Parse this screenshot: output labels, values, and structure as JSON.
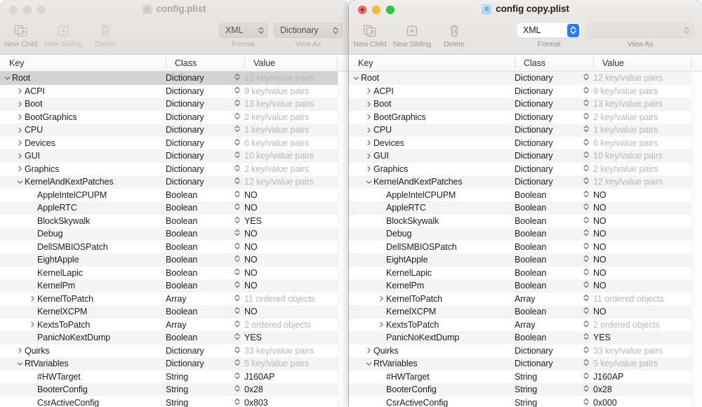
{
  "windows": [
    {
      "id": "left",
      "state": "inactive",
      "title": "config.plist",
      "doc_icon": "plist-document-icon",
      "traffic_lights": [
        "close-button",
        "minimize-button",
        "zoom-button"
      ],
      "toolbar": {
        "items": [
          {
            "label": "New Child",
            "icon": "new-child-icon",
            "enabled": true
          },
          {
            "label": "New Sibling",
            "icon": "new-sibling-icon",
            "enabled": false
          },
          {
            "label": "Delete",
            "icon": "trash-icon",
            "enabled": false
          }
        ],
        "format_popup": {
          "value": "XML",
          "sublabel": "Format"
        },
        "viewas_popup": {
          "value": "Dictionary",
          "sublabel": "View As"
        }
      },
      "columns": [
        "Key",
        "Class",
        "Value"
      ],
      "rows": [
        {
          "key": "Root",
          "class": "Dictionary",
          "value": "12 key/value pairs",
          "indent": 0,
          "disclosure": "open",
          "muted_value": true,
          "selected": true,
          "value_stepper": false
        },
        {
          "key": "ACPI",
          "class": "Dictionary",
          "value": "9 key/value pairs",
          "indent": 1,
          "disclosure": "closed",
          "muted_value": true,
          "selected": false,
          "value_stepper": false
        },
        {
          "key": "Boot",
          "class": "Dictionary",
          "value": "13 key/value pairs",
          "indent": 1,
          "disclosure": "closed",
          "muted_value": true,
          "selected": false,
          "value_stepper": false
        },
        {
          "key": "BootGraphics",
          "class": "Dictionary",
          "value": "2 key/value pairs",
          "indent": 1,
          "disclosure": "closed",
          "muted_value": true,
          "selected": false,
          "value_stepper": false
        },
        {
          "key": "CPU",
          "class": "Dictionary",
          "value": "1 key/value pairs",
          "indent": 1,
          "disclosure": "closed",
          "muted_value": true,
          "selected": false,
          "value_stepper": false
        },
        {
          "key": "Devices",
          "class": "Dictionary",
          "value": "6 key/value pairs",
          "indent": 1,
          "disclosure": "closed",
          "muted_value": true,
          "selected": false,
          "value_stepper": false
        },
        {
          "key": "GUI",
          "class": "Dictionary",
          "value": "10 key/value pairs",
          "indent": 1,
          "disclosure": "closed",
          "muted_value": true,
          "selected": false,
          "value_stepper": false
        },
        {
          "key": "Graphics",
          "class": "Dictionary",
          "value": "2 key/value pairs",
          "indent": 1,
          "disclosure": "closed",
          "muted_value": true,
          "selected": false,
          "value_stepper": false
        },
        {
          "key": "KernelAndKextPatches",
          "class": "Dictionary",
          "value": "12 key/value pairs",
          "indent": 1,
          "disclosure": "open",
          "muted_value": true,
          "selected": false,
          "value_stepper": false
        },
        {
          "key": "AppleIntelCPUPM",
          "class": "Boolean",
          "value": "NO",
          "indent": 2,
          "disclosure": "none",
          "muted_value": false,
          "selected": false,
          "value_stepper": true
        },
        {
          "key": "AppleRTC",
          "class": "Boolean",
          "value": "NO",
          "indent": 2,
          "disclosure": "none",
          "muted_value": false,
          "selected": false,
          "value_stepper": true
        },
        {
          "key": "BlockSkywalk",
          "class": "Boolean",
          "value": "YES",
          "indent": 2,
          "disclosure": "none",
          "muted_value": false,
          "selected": false,
          "value_stepper": true
        },
        {
          "key": "Debug",
          "class": "Boolean",
          "value": "NO",
          "indent": 2,
          "disclosure": "none",
          "muted_value": false,
          "selected": false,
          "value_stepper": true
        },
        {
          "key": "DellSMBIOSPatch",
          "class": "Boolean",
          "value": "NO",
          "indent": 2,
          "disclosure": "none",
          "muted_value": false,
          "selected": false,
          "value_stepper": true
        },
        {
          "key": "EightApple",
          "class": "Boolean",
          "value": "NO",
          "indent": 2,
          "disclosure": "none",
          "muted_value": false,
          "selected": false,
          "value_stepper": true
        },
        {
          "key": "KernelLapic",
          "class": "Boolean",
          "value": "NO",
          "indent": 2,
          "disclosure": "none",
          "muted_value": false,
          "selected": false,
          "value_stepper": true
        },
        {
          "key": "KernelPm",
          "class": "Boolean",
          "value": "NO",
          "indent": 2,
          "disclosure": "none",
          "muted_value": false,
          "selected": false,
          "value_stepper": true
        },
        {
          "key": "KernelToPatch",
          "class": "Array",
          "value": "11 ordered objects",
          "indent": 2,
          "disclosure": "closed",
          "muted_value": true,
          "selected": false,
          "value_stepper": false
        },
        {
          "key": "KernelXCPM",
          "class": "Boolean",
          "value": "NO",
          "indent": 2,
          "disclosure": "none",
          "muted_value": false,
          "selected": false,
          "value_stepper": true
        },
        {
          "key": "KextsToPatch",
          "class": "Array",
          "value": "2 ordered objects",
          "indent": 2,
          "disclosure": "closed",
          "muted_value": true,
          "selected": false,
          "value_stepper": false
        },
        {
          "key": "PanicNoKextDump",
          "class": "Boolean",
          "value": "YES",
          "indent": 2,
          "disclosure": "none",
          "muted_value": false,
          "selected": false,
          "value_stepper": true
        },
        {
          "key": "Quirks",
          "class": "Dictionary",
          "value": "33 key/value pairs",
          "indent": 1,
          "disclosure": "closed",
          "muted_value": true,
          "selected": false,
          "value_stepper": false
        },
        {
          "key": "RtVariables",
          "class": "Dictionary",
          "value": "5 key/value pairs",
          "indent": 1,
          "disclosure": "open",
          "muted_value": true,
          "selected": false,
          "value_stepper": false
        },
        {
          "key": "#HWTarget",
          "class": "String",
          "value": "J160AP",
          "indent": 2,
          "disclosure": "none",
          "muted_value": false,
          "selected": false,
          "value_stepper": false
        },
        {
          "key": "BooterConfig",
          "class": "String",
          "value": "0x28",
          "indent": 2,
          "disclosure": "none",
          "muted_value": false,
          "selected": false,
          "value_stepper": false
        },
        {
          "key": "CsrActiveConfig",
          "class": "String",
          "value": "0x803",
          "indent": 2,
          "disclosure": "none",
          "muted_value": false,
          "selected": false,
          "value_stepper": false
        }
      ]
    },
    {
      "id": "right",
      "state": "active",
      "title": "config copy.plist",
      "doc_icon": "plist-document-icon",
      "traffic_lights": [
        "close-button",
        "minimize-button",
        "zoom-button"
      ],
      "toolbar": {
        "items": [
          {
            "label": "New Child",
            "icon": "new-child-icon",
            "enabled": true
          },
          {
            "label": "New Sibling",
            "icon": "new-sibling-icon",
            "enabled": true
          },
          {
            "label": "Delete",
            "icon": "trash-icon",
            "enabled": true
          }
        ],
        "format_popup": {
          "value": "XML",
          "sublabel": "Format"
        },
        "viewas_popup": {
          "value": "",
          "sublabel": "View As"
        }
      },
      "columns": [
        "Key",
        "Class",
        "Value"
      ],
      "rows": [
        {
          "key": "Root",
          "class": "Dictionary",
          "value": "12 key/value pairs",
          "indent": 0,
          "disclosure": "open",
          "muted_value": true,
          "selected": false,
          "value_stepper": false
        },
        {
          "key": "ACPI",
          "class": "Dictionary",
          "value": "9 key/value pairs",
          "indent": 1,
          "disclosure": "closed",
          "muted_value": true,
          "selected": false,
          "value_stepper": false
        },
        {
          "key": "Boot",
          "class": "Dictionary",
          "value": "13 key/value pairs",
          "indent": 1,
          "disclosure": "closed",
          "muted_value": true,
          "selected": false,
          "value_stepper": false
        },
        {
          "key": "BootGraphics",
          "class": "Dictionary",
          "value": "2 key/value pairs",
          "indent": 1,
          "disclosure": "closed",
          "muted_value": true,
          "selected": false,
          "value_stepper": false
        },
        {
          "key": "CPU",
          "class": "Dictionary",
          "value": "1 key/value pairs",
          "indent": 1,
          "disclosure": "closed",
          "muted_value": true,
          "selected": false,
          "value_stepper": false
        },
        {
          "key": "Devices",
          "class": "Dictionary",
          "value": "6 key/value pairs",
          "indent": 1,
          "disclosure": "closed",
          "muted_value": true,
          "selected": false,
          "value_stepper": false
        },
        {
          "key": "GUI",
          "class": "Dictionary",
          "value": "10 key/value pairs",
          "indent": 1,
          "disclosure": "closed",
          "muted_value": true,
          "selected": false,
          "value_stepper": false
        },
        {
          "key": "Graphics",
          "class": "Dictionary",
          "value": "2 key/value pairs",
          "indent": 1,
          "disclosure": "closed",
          "muted_value": true,
          "selected": false,
          "value_stepper": false
        },
        {
          "key": "KernelAndKextPatches",
          "class": "Dictionary",
          "value": "12 key/value pairs",
          "indent": 1,
          "disclosure": "open",
          "muted_value": true,
          "selected": false,
          "value_stepper": false
        },
        {
          "key": "AppleIntelCPUPM",
          "class": "Boolean",
          "value": "NO",
          "indent": 2,
          "disclosure": "none",
          "muted_value": false,
          "selected": false,
          "value_stepper": true
        },
        {
          "key": "AppleRTC",
          "class": "Boolean",
          "value": "NO",
          "indent": 2,
          "disclosure": "none",
          "muted_value": false,
          "selected": false,
          "value_stepper": true
        },
        {
          "key": "BlockSkywalk",
          "class": "Boolean",
          "value": "NO",
          "indent": 2,
          "disclosure": "none",
          "muted_value": false,
          "selected": false,
          "value_stepper": true
        },
        {
          "key": "Debug",
          "class": "Boolean",
          "value": "NO",
          "indent": 2,
          "disclosure": "none",
          "muted_value": false,
          "selected": false,
          "value_stepper": true
        },
        {
          "key": "DellSMBIOSPatch",
          "class": "Boolean",
          "value": "NO",
          "indent": 2,
          "disclosure": "none",
          "muted_value": false,
          "selected": false,
          "value_stepper": true
        },
        {
          "key": "EightApple",
          "class": "Boolean",
          "value": "NO",
          "indent": 2,
          "disclosure": "none",
          "muted_value": false,
          "selected": false,
          "value_stepper": true
        },
        {
          "key": "KernelLapic",
          "class": "Boolean",
          "value": "NO",
          "indent": 2,
          "disclosure": "none",
          "muted_value": false,
          "selected": false,
          "value_stepper": true
        },
        {
          "key": "KernelPm",
          "class": "Boolean",
          "value": "NO",
          "indent": 2,
          "disclosure": "none",
          "muted_value": false,
          "selected": false,
          "value_stepper": true
        },
        {
          "key": "KernelToPatch",
          "class": "Array",
          "value": "11 ordered objects",
          "indent": 2,
          "disclosure": "closed",
          "muted_value": true,
          "selected": false,
          "value_stepper": false
        },
        {
          "key": "KernelXCPM",
          "class": "Boolean",
          "value": "NO",
          "indent": 2,
          "disclosure": "none",
          "muted_value": false,
          "selected": false,
          "value_stepper": true
        },
        {
          "key": "KextsToPatch",
          "class": "Array",
          "value": "2 ordered objects",
          "indent": 2,
          "disclosure": "closed",
          "muted_value": true,
          "selected": false,
          "value_stepper": false
        },
        {
          "key": "PanicNoKextDump",
          "class": "Boolean",
          "value": "YES",
          "indent": 2,
          "disclosure": "none",
          "muted_value": false,
          "selected": false,
          "value_stepper": true
        },
        {
          "key": "Quirks",
          "class": "Dictionary",
          "value": "33 key/value pairs",
          "indent": 1,
          "disclosure": "closed",
          "muted_value": true,
          "selected": false,
          "value_stepper": false
        },
        {
          "key": "RtVariables",
          "class": "Dictionary",
          "value": "5 key/value pairs",
          "indent": 1,
          "disclosure": "open",
          "muted_value": true,
          "selected": false,
          "value_stepper": false
        },
        {
          "key": "#HWTarget",
          "class": "String",
          "value": "J160AP",
          "indent": 2,
          "disclosure": "none",
          "muted_value": false,
          "selected": false,
          "value_stepper": false
        },
        {
          "key": "BooterConfig",
          "class": "String",
          "value": "0x28",
          "indent": 2,
          "disclosure": "none",
          "muted_value": false,
          "selected": false,
          "value_stepper": false
        },
        {
          "key": "CsrActiveConfig",
          "class": "String",
          "value": "0x000",
          "indent": 2,
          "disclosure": "none",
          "muted_value": false,
          "selected": false,
          "value_stepper": false
        }
      ]
    }
  ],
  "colors": {
    "accent_blue": "#2a7cf6",
    "selection_gray": "#d5d3d1",
    "stripe_gray": "#f4f4f4",
    "muted_text": "#b9b7b5",
    "text": "#1d1d1f"
  }
}
